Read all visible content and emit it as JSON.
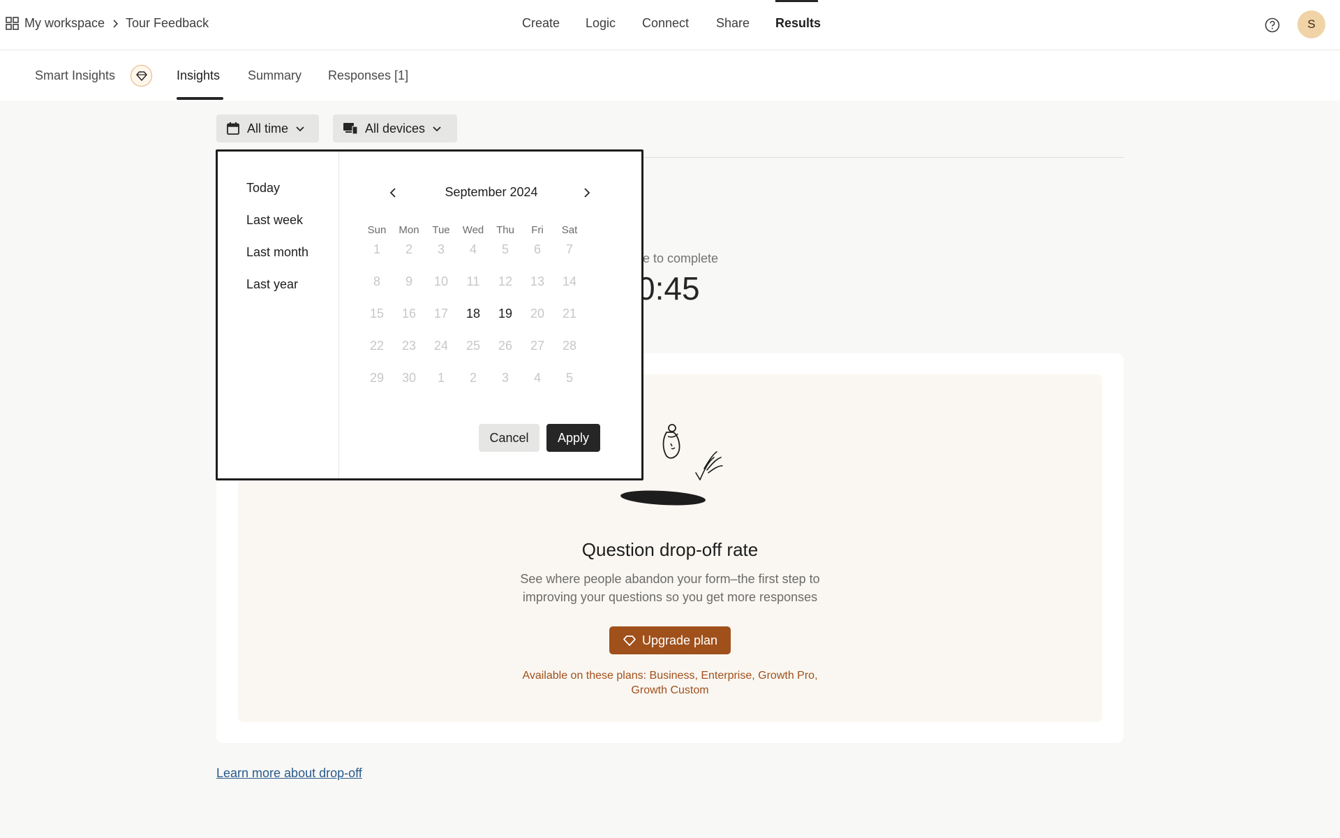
{
  "breadcrumb": {
    "workspace": "My workspace",
    "form": "Tour Feedback"
  },
  "topnav": {
    "items": [
      "Create",
      "Logic",
      "Connect",
      "Share",
      "Results"
    ],
    "active": "Results"
  },
  "avatar": {
    "initial": "S",
    "color": "#f0d3a6"
  },
  "subtabs": {
    "smart_insights": "Smart Insights",
    "insights": "Insights",
    "summary": "Summary",
    "responses": "Responses [1]",
    "active": "Insights"
  },
  "filters": {
    "time": "All time",
    "devices": "All devices"
  },
  "date_picker": {
    "presets": [
      "Today",
      "Last week",
      "Last month",
      "Last year"
    ],
    "month_label": "September 2024",
    "weekdays": [
      "Sun",
      "Mon",
      "Tue",
      "Wed",
      "Thu",
      "Fri",
      "Sat"
    ],
    "weeks": [
      [
        "1",
        "2",
        "3",
        "4",
        "5",
        "6",
        "7"
      ],
      [
        "8",
        "9",
        "10",
        "11",
        "12",
        "13",
        "14"
      ],
      [
        "15",
        "16",
        "17",
        "18",
        "19",
        "20",
        "21"
      ],
      [
        "22",
        "23",
        "24",
        "25",
        "26",
        "27",
        "28"
      ],
      [
        "29",
        "30",
        "1",
        "2",
        "3",
        "4",
        "5"
      ]
    ],
    "enabled_days": [
      "18",
      "19"
    ],
    "cancel_label": "Cancel",
    "apply_label": "Apply"
  },
  "metric": {
    "label_fragment": "e to complete",
    "value_fragment": "0:45"
  },
  "dropoff_card": {
    "title": "Question drop-off rate",
    "description": "See where people abandon your form–the first step to improving your questions so you get more responses",
    "upgrade_label": "Upgrade plan",
    "plans_note": "Available on these plans: Business, Enterprise, Growth Pro, Growth Custom"
  },
  "learn_more": "Learn more about drop-off",
  "colors": {
    "accent": "#a0501b",
    "dark": "#262627",
    "card_bg": "#faf7f2"
  }
}
